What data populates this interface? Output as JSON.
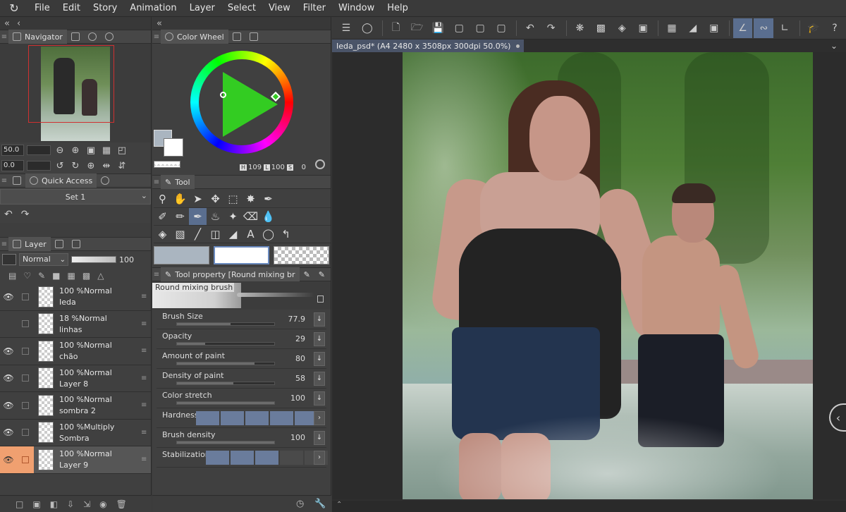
{
  "menu": {
    "items": [
      "File",
      "Edit",
      "Story",
      "Animation",
      "Layer",
      "Select",
      "View",
      "Filter",
      "Window",
      "Help"
    ]
  },
  "navigator": {
    "tab_label": "Navigator",
    "zoom_value": "50.0",
    "rotate_value": "0.0"
  },
  "quick_access": {
    "tab_label": "Quick Access",
    "set_label": "Set 1"
  },
  "layer": {
    "tab_label": "Layer",
    "blend_mode": "Normal",
    "opacity": "100",
    "rows": [
      {
        "opacity": "100 %",
        "mode": "Normal",
        "name": "Ieda",
        "visible": true,
        "selected": false
      },
      {
        "opacity": "18 %",
        "mode": "Normal",
        "name": "linhas",
        "visible": false,
        "selected": false
      },
      {
        "opacity": "100 %",
        "mode": "Normal",
        "name": "chão",
        "visible": true,
        "selected": false
      },
      {
        "opacity": "100 %",
        "mode": "Normal",
        "name": "Layer 8",
        "visible": true,
        "selected": false
      },
      {
        "opacity": "100 %",
        "mode": "Normal",
        "name": "sombra 2",
        "visible": true,
        "selected": false
      },
      {
        "opacity": "100 %",
        "mode": "Multiply",
        "name": "Sombra",
        "visible": true,
        "selected": false
      },
      {
        "opacity": "100 %",
        "mode": "Normal",
        "name": "Layer 9",
        "visible": true,
        "selected": true
      }
    ]
  },
  "color_wheel": {
    "tab_label": "Color Wheel",
    "h_label": "H",
    "h_value": "109",
    "l_label": "L",
    "l_value": "100",
    "s_label": "S",
    "s_value": "0",
    "main_color": "#aab5c0",
    "sub_color": "#ffffff",
    "hue_color": "#33cc22"
  },
  "tool": {
    "tab_label": "Tool"
  },
  "tool_property": {
    "tab_label": "Tool property [Round mixing br",
    "brush_name": "Round mixing brush",
    "props": [
      {
        "label": "Brush Size",
        "value": "77.9",
        "fill": 0.55
      },
      {
        "label": "Opacity",
        "value": "29",
        "fill": 0.29
      },
      {
        "label": "Amount of paint",
        "value": "80",
        "fill": 0.8
      },
      {
        "label": "Density of paint",
        "value": "58",
        "fill": 0.58
      },
      {
        "label": "Color stretch",
        "value": "100",
        "fill": 1.0
      }
    ],
    "hardness_label": "Hardness",
    "hardness_level": 5,
    "brush_density_label": "Brush density",
    "brush_density_value": "100",
    "brush_density_fill": 1.0,
    "stabilization_label": "Stabilization",
    "stabilization_level": 3
  },
  "document": {
    "tab_title": "Ieda_psd* (A4 2480 x 3508px 300dpi 50.0%)"
  }
}
